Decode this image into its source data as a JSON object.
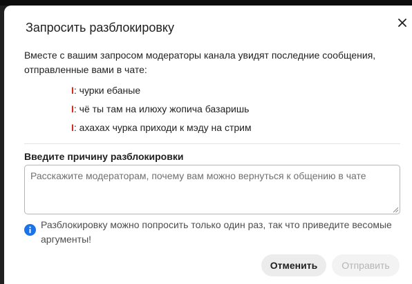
{
  "dialog": {
    "title": "Запросить разблокировку",
    "close_icon": "close-icon",
    "intro": "Вместе с вашим запросом модераторы канала увидят последние сообщения, отправленные вами в чате:",
    "messages": [
      {
        "user": "I",
        "text": ": чурки ебаные"
      },
      {
        "user": "I",
        "text": ": чё ты там на илюху жопича базаришь"
      },
      {
        "user": "I",
        "text": ": ахахах чурка приходи к мэду на стрим"
      }
    ],
    "reason_label": "Введите причину разблокировки",
    "reason_value": "",
    "reason_placeholder": "Расскажите модераторам, почему вам можно вернуться к общению в чате",
    "info_icon": "info-icon",
    "info_text": "Разблокировку можно попросить только один раз, так что приведите весомые аргументы!",
    "cancel_label": "Отменить",
    "submit_label": "Отправить",
    "submit_disabled": true
  },
  "colors": {
    "username": "#d4271c",
    "info_icon": "#1a73e8",
    "text": "#1f1f1f",
    "muted_text": "#4d4d4d",
    "disabled_text": "#b5b5b5",
    "cancel_bg": "#ececec"
  }
}
